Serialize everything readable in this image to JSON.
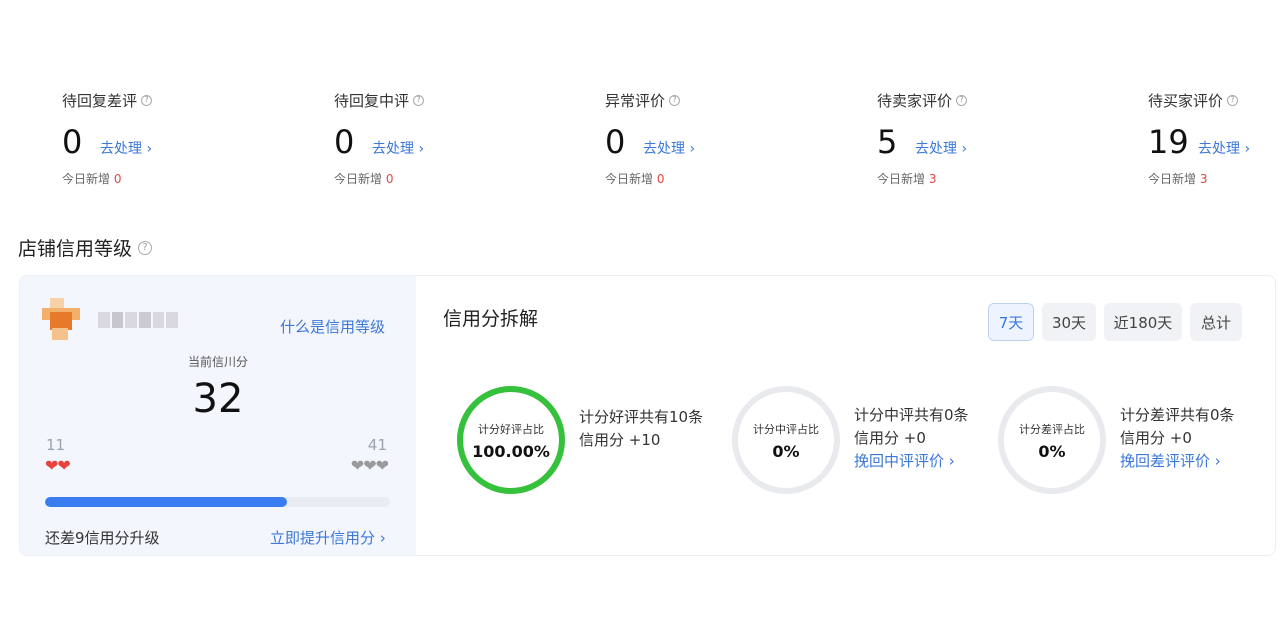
{
  "stats": [
    {
      "title": "待回复差评",
      "value": "0",
      "link": "去处理 ›",
      "today_label": "今日新增",
      "today_value": "0"
    },
    {
      "title": "待回复中评",
      "value": "0",
      "link": "去处理 ›",
      "today_label": "今日新增",
      "today_value": "0"
    },
    {
      "title": "异常评价",
      "value": "0",
      "link": "去处理 ›",
      "today_label": "今日新增",
      "today_value": "0"
    },
    {
      "title": "待卖家评价",
      "value": "5",
      "link": "去处理 ›",
      "today_label": "今日新增",
      "today_value": "3"
    },
    {
      "title": "待买家评价",
      "value": "19",
      "link": "去处理 ›",
      "today_label": "今日新增",
      "today_value": "3"
    }
  ],
  "section": {
    "title": "店铺信用等级"
  },
  "credit": {
    "what_link": "什么是信用等级",
    "current_label": "当前信川分",
    "current_score": "32",
    "level_min": "11",
    "level_max": "41",
    "progress_percent": 70,
    "upgrade_text": "还差9信用分升级",
    "upgrade_link": "立即提升信用分 ›"
  },
  "breakdown": {
    "title": "信用分拆解",
    "periods": [
      "7天",
      "30天",
      "近180天",
      "总计"
    ],
    "active_period": "7天",
    "rings": [
      {
        "label": "计分好评占比",
        "value": "100.00%",
        "ratio": 1.0,
        "color": "#35c13b",
        "desc_line1": "计分好评共有10条",
        "desc_line2": "信用分 +10",
        "link": ""
      },
      {
        "label": "计分中评占比",
        "value": "0%",
        "ratio": 0,
        "color": "#35c13b",
        "desc_line1": "计分中评共有0条",
        "desc_line2": "信用分 +0",
        "link": "挽回中评评价 ›"
      },
      {
        "label": "计分差评占比",
        "value": "0%",
        "ratio": 0,
        "color": "#35c13b",
        "desc_line1": "计分差评共有0条",
        "desc_line2": "信用分 +0",
        "link": "挽回差评评价 ›"
      }
    ]
  },
  "colors": {
    "accent": "#3b78d8",
    "progress": "#3a7df0",
    "ring_track": "#e8eaee",
    "ring_good": "#35c13b",
    "hearts_active": "#e8443f",
    "hearts_inactive": "#9a9a9a"
  },
  "icons": {
    "help": "question-circle-icon",
    "heart_active": "heart-red-icon",
    "heart_inactive": "heart-grey-icon",
    "shop_avatar": "shop-avatar-icon"
  }
}
